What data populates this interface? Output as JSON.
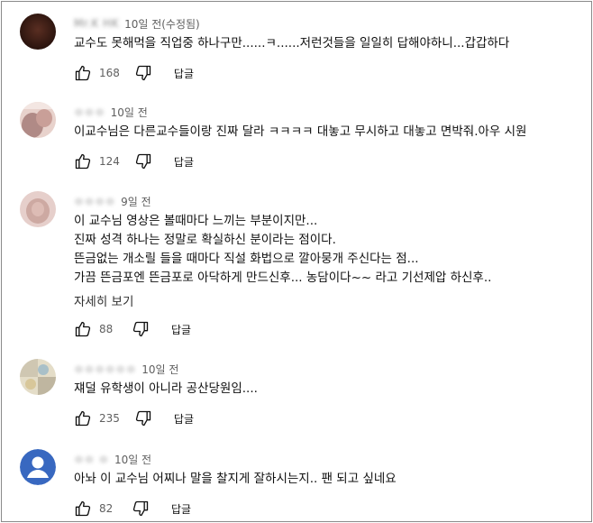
{
  "comments": [
    {
      "author": "Mr.K HK",
      "time": "10일 전(수정됨)",
      "lines": [
        "교수도 못해먹을 직업중 하나구만......ㅋ......저런것들을 일일히 답해야하니...갑갑하다"
      ],
      "likes": "168",
      "reply_label": "답글",
      "avatar_icon": "user-photo",
      "avatar_color": "#3a1d14"
    },
    {
      "author": "ㅇㅇㅇ",
      "time": "10일 전",
      "lines": [
        "이교수님은 다른교수들이랑 진짜 달라 ㅋㅋㅋㅋ 대놓고 무시하고 대놓고 면박줘.아우 시원"
      ],
      "likes": "124",
      "reply_label": "답글",
      "avatar_icon": "user-photo",
      "avatar_color": "#c9a8a4"
    },
    {
      "author": "ㅇㅇㅇㅇ",
      "time": "9일 전",
      "lines": [
        "이 교수님 영상은 볼때마다 느끼는 부분이지만...",
        "진짜 성격 하나는 정말로 확실하신 분이라는 점이다.",
        "뜬금없는 개소릴 들을 때마다 직설 화법으로 깔아뭉개 주신다는 점...",
        "가끔 뜬금포엔 뜬금포로 아닥하게 만드신후... 농담이다~~ 라고 기선제압 하신후.."
      ],
      "more_label": "자세히 보기",
      "likes": "88",
      "reply_label": "답글",
      "avatar_icon": "user-photo",
      "avatar_color": "#d6b8b4"
    },
    {
      "author": "ㅇㅇㅇㅇㅇㅇ",
      "time": "10일 전",
      "lines": [
        "쟤덜 유학생이 아니라 공산당원임...."
      ],
      "likes": "235",
      "reply_label": "답글",
      "avatar_icon": "user-photo",
      "avatar_color": "#c8c0a8"
    },
    {
      "author": "ㅇㅇ ㅇ",
      "time": "10일 전",
      "lines": [
        "아놔 이 교수님 어찌나 말을 찰지게 잘하시는지.. 팬 되고 싶네요"
      ],
      "likes": "82",
      "reply_label": "답글",
      "avatar_icon": "default-avatar-icon",
      "avatar_color": "#3868c0"
    }
  ]
}
